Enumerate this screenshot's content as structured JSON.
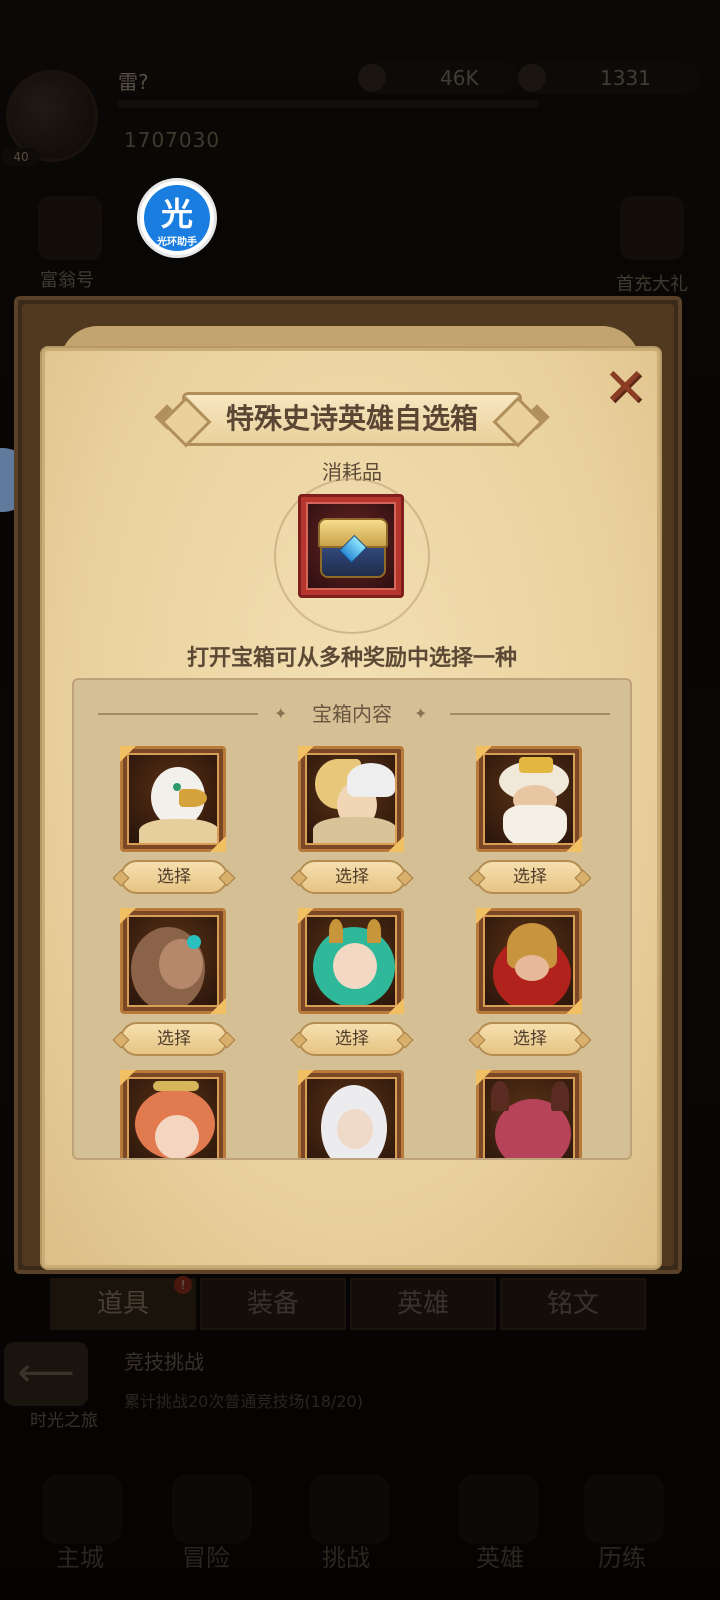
{
  "background": {
    "player": {
      "name": "雷?",
      "level": "40",
      "power": "1707030"
    },
    "resources": [
      {
        "icon": "gold-coin-icon",
        "value": "46K"
      },
      {
        "icon": "diamond-icon",
        "value": "1331"
      }
    ],
    "side_left_label": "富翁号",
    "side_right_label": "首充大礼",
    "floating_badge": {
      "glyph": "光",
      "caption": "光环助手"
    },
    "tabs": [
      {
        "label": "道具",
        "active": true,
        "badge": "!"
      },
      {
        "label": "装备"
      },
      {
        "label": "英雄"
      },
      {
        "label": "铭文"
      }
    ],
    "quest": {
      "title": "竞技挑战",
      "desc": "累计挑战20次普通竞技场(18/20)",
      "back_label": "时光之旅",
      "arrow": "⟵"
    },
    "bottom_nav": [
      "主城",
      "冒险",
      "挑战",
      "英雄",
      "历练"
    ]
  },
  "popup": {
    "close_symbol": "✕",
    "title": "特殊史诗英雄自选箱",
    "item_type": "消耗品",
    "item_icon": "treasure-chest-icon",
    "description": "打开宝箱可从多种奖励中选择一种",
    "contents_header": "宝箱内容",
    "header_star": "✦",
    "select_label": "选择",
    "heroes": [
      {
        "icon": "griffin-hero-icon"
      },
      {
        "icon": "winged-knight-hero-icon"
      },
      {
        "icon": "white-beard-king-hero-icon"
      },
      {
        "icon": "brown-hair-woman-hero-icon"
      },
      {
        "icon": "green-hair-dryad-hero-icon"
      },
      {
        "icon": "red-helmet-warrior-hero-icon"
      },
      {
        "icon": "orange-hair-girl-hero-icon"
      },
      {
        "icon": "white-hair-elf-hero-icon"
      },
      {
        "icon": "horned-demon-hero-icon"
      }
    ]
  }
}
